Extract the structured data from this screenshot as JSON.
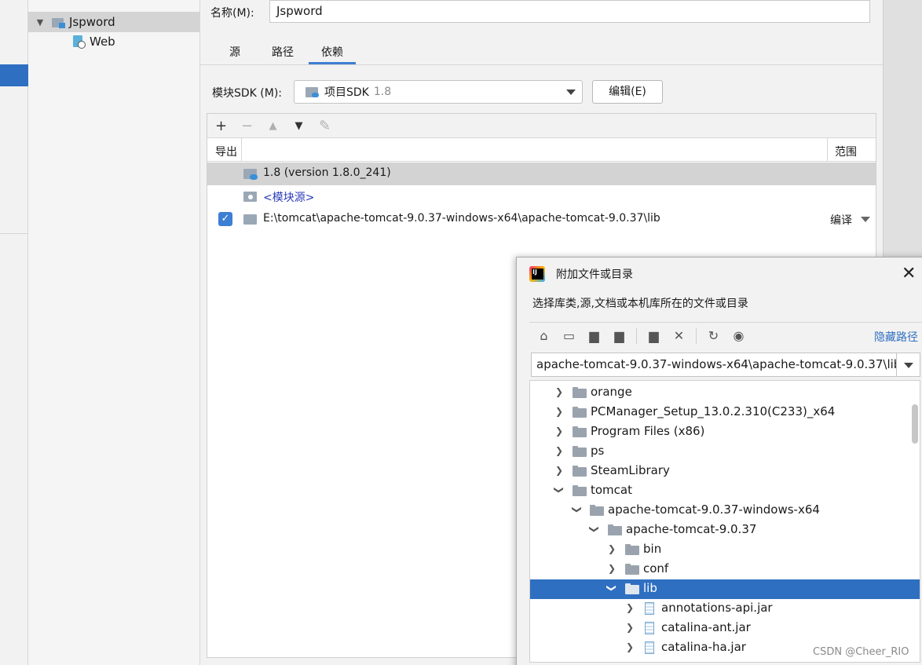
{
  "colors": {
    "accent": "#2f6fc1",
    "selected_row": "#d3d3d3",
    "checkbox": "#3d7fd4"
  },
  "module_tree": {
    "items": [
      {
        "label": "Jspword",
        "icon": "module-icon",
        "expanded": true
      },
      {
        "label": "Web",
        "icon": "web-facet-icon"
      }
    ]
  },
  "settings": {
    "name_label": "名称(M):",
    "name_value": "Jspword",
    "tabs": [
      {
        "label": "源"
      },
      {
        "label": "路径"
      },
      {
        "label": "依赖",
        "active": true
      }
    ],
    "sdk_label": "模块SDK (M):",
    "sdk_value": "项目SDK",
    "sdk_version": "1.8",
    "edit_button": "编辑(E)"
  },
  "deps": {
    "toolbar": [
      {
        "icon": "plus-icon",
        "glyph": "+"
      },
      {
        "icon": "minus-icon",
        "glyph": "−"
      },
      {
        "icon": "move-up-icon",
        "glyph": "▲"
      },
      {
        "icon": "move-down-icon",
        "glyph": "▼"
      },
      {
        "icon": "edit-pencil-icon",
        "glyph": "✎"
      }
    ],
    "header": {
      "export": "导出",
      "scope": "范围"
    },
    "rows": [
      {
        "label": "1.8 (version 1.8.0_241)",
        "selected": true
      },
      {
        "label": "<模块源>"
      },
      {
        "label": "E:\\tomcat\\apache-tomcat-9.0.37-windows-x64\\apache-tomcat-9.0.37\\lib",
        "checked": true,
        "scope": "编译"
      }
    ]
  },
  "dialog": {
    "title": "附加文件或目录",
    "description": "选择库类,源,文档或本机库所在的文件或目录",
    "hide_path": "隐藏路径",
    "path_value": "apache-tomcat-9.0.37-windows-x64\\apache-tomcat-9.0.37\\lib",
    "tree": [
      {
        "label": "orange",
        "depth": 0,
        "type": "folder",
        "arrow": "right"
      },
      {
        "label": "PCManager_Setup_13.0.2.310(C233)_x64",
        "depth": 0,
        "type": "folder",
        "arrow": "right"
      },
      {
        "label": "Program Files (x86)",
        "depth": 0,
        "type": "folder",
        "arrow": "right"
      },
      {
        "label": "ps",
        "depth": 0,
        "type": "folder",
        "arrow": "right"
      },
      {
        "label": "SteamLibrary",
        "depth": 0,
        "type": "folder",
        "arrow": "right"
      },
      {
        "label": "tomcat",
        "depth": 0,
        "type": "folder",
        "arrow": "down"
      },
      {
        "label": "apache-tomcat-9.0.37-windows-x64",
        "depth": 1,
        "type": "folder",
        "arrow": "down"
      },
      {
        "label": "apache-tomcat-9.0.37",
        "depth": 2,
        "type": "folder",
        "arrow": "down"
      },
      {
        "label": "bin",
        "depth": 3,
        "type": "folder",
        "arrow": "right"
      },
      {
        "label": "conf",
        "depth": 3,
        "type": "folder",
        "arrow": "right"
      },
      {
        "label": "lib",
        "depth": 3,
        "type": "folder",
        "arrow": "down",
        "selected": true
      },
      {
        "label": "annotations-api.jar",
        "depth": 4,
        "type": "jar",
        "arrow": "right"
      },
      {
        "label": "catalina-ant.jar",
        "depth": 4,
        "type": "jar",
        "arrow": "right"
      },
      {
        "label": "catalina-ha.jar",
        "depth": 4,
        "type": "jar",
        "arrow": "right"
      }
    ]
  },
  "watermark": "CSDN @Cheer_RIO"
}
